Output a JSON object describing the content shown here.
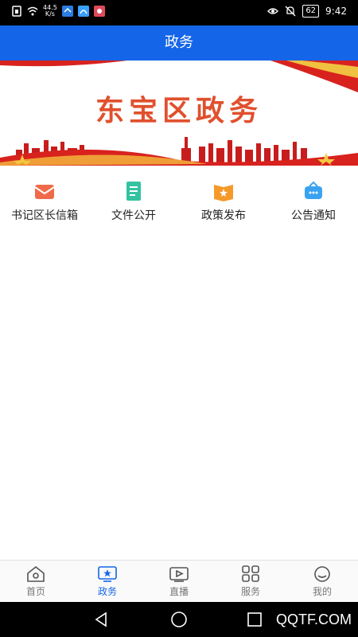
{
  "status_bar": {
    "net_speed_value": "44.5",
    "net_speed_unit": "K/s",
    "battery": "62",
    "time": "9:42"
  },
  "header": {
    "title": "政务"
  },
  "banner": {
    "title": "东宝区政务",
    "accent": "#e0502d"
  },
  "menu": {
    "items": [
      {
        "label": "书记区长信箱",
        "icon": "mail-icon"
      },
      {
        "label": "文件公开",
        "icon": "document-icon"
      },
      {
        "label": "政策发布",
        "icon": "book-icon"
      },
      {
        "label": "公告通知",
        "icon": "notice-icon"
      }
    ]
  },
  "bottom_nav": {
    "active_color": "#1565e8",
    "items": [
      {
        "label": "首页",
        "icon": "home-icon"
      },
      {
        "label": "政务",
        "icon": "government-icon",
        "active": true
      },
      {
        "label": "直播",
        "icon": "live-video-icon"
      },
      {
        "label": "服务",
        "icon": "grid-icon"
      },
      {
        "label": "我的",
        "icon": "profile-icon"
      }
    ]
  },
  "watermark": {
    "text": "QQTF.COM"
  }
}
